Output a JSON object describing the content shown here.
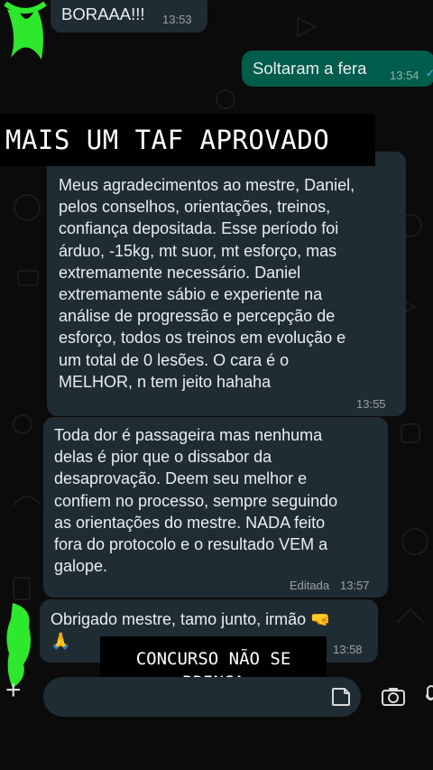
{
  "messages": [
    {
      "direction": "in",
      "text": "BORAAA!!!",
      "time": "13:53"
    },
    {
      "direction": "out",
      "text": "Soltaram a fera",
      "time": "13:54",
      "status": "double-check-icon"
    },
    {
      "direction": "in",
      "text": "Meus agradecimentos ao mestre, Daniel,\npelos conselhos, orientações, treinos,\nconfiança depositada. Esse período foi\nárduo, -15kg, mt suor, mt esforço, mas\nextremamente necessário. Daniel\nextremamente sábio e experiente na\nanálise de progressão e percepção de\nesforço, todos os treinos em evolução e\num total de 0 lesões. O cara é o\nMELHOR, n tem jeito hahaha",
      "time": "13:55"
    },
    {
      "direction": "in",
      "text": "Toda dor é passageira mas nenhuma\ndelas é pior que o dissabor da\ndesaprovação. Deem seu melhor e\nconfiem no processo, sempre seguindo\nas orientações do mestre. NADA feito\nfora do protocolo e o resultado VEM a\ngalope.",
      "time": "13:57",
      "edited_label": "Editada"
    },
    {
      "direction": "in",
      "text": "Obrigado mestre, tamo junto, irmão 🤜\n🙏",
      "time": "13:58"
    }
  ],
  "captions": {
    "top": "MAIS UM TAF APROVADO",
    "bottom": "CONCURSO NÃO SE\nBRINCA"
  },
  "composer": {
    "icons": [
      "plus-icon",
      "sticker-icon",
      "camera-icon",
      "mic-icon"
    ]
  },
  "colors": {
    "incoming_bubble": "#202c33",
    "outgoing_bubble": "#005c4b",
    "scribble_green": "#2ee82e",
    "background": "#0b0b0b"
  }
}
